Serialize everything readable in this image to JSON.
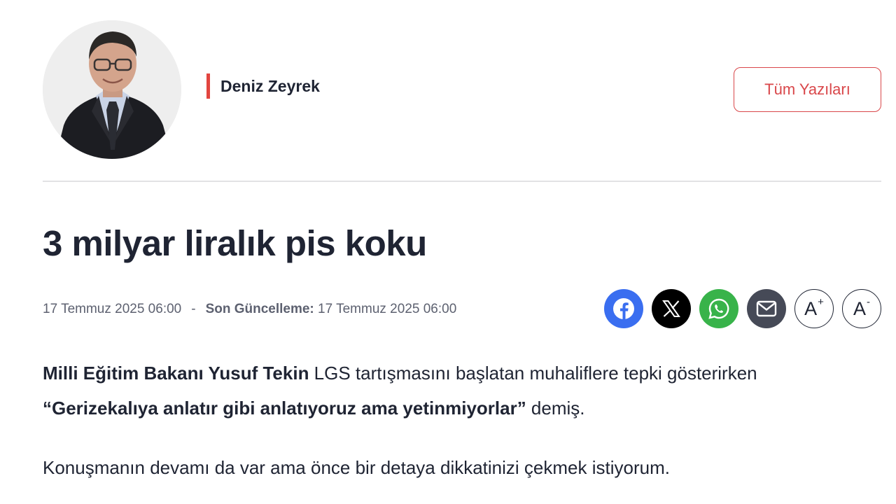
{
  "author": {
    "name": "Deniz Zeyrek",
    "all_posts_label": "Tüm Yazıları"
  },
  "article": {
    "title": "3 milyar liralık pis koku",
    "published": "17 Temmuz 2025 06:00",
    "separator": "-",
    "updated_label": "Son Güncelleme:",
    "updated": "17 Temmuz 2025 06:00",
    "p1_bold": "Milli Eğitim Bakanı Yusuf Tekin",
    "p1_text": " LGS tartışmasını başlatan muhaliflere tepki gösterirken ",
    "p1_quote": "“Gerizekalıya anlatır gibi anlatıyoruz ama yetinmiyorlar”",
    "p1_end": " demiş.",
    "p2": "Konuşmanın devamı da var ama önce bir detaya dikkatinizi çekmek istiyorum."
  },
  "share": {
    "items": [
      {
        "icon": "facebook-icon",
        "color": "#3a6ef0"
      },
      {
        "icon": "x-icon",
        "color": "#000000"
      },
      {
        "icon": "whatsapp-icon",
        "color": "#38b34a"
      },
      {
        "icon": "mail-icon",
        "color": "#464a57"
      }
    ],
    "font_increase": {
      "letter": "A",
      "sign": "+"
    },
    "font_decrease": {
      "letter": "A",
      "sign": "-"
    }
  },
  "colors": {
    "accent": "#d9474a",
    "text": "#1f2433",
    "meta": "#5d6170"
  }
}
